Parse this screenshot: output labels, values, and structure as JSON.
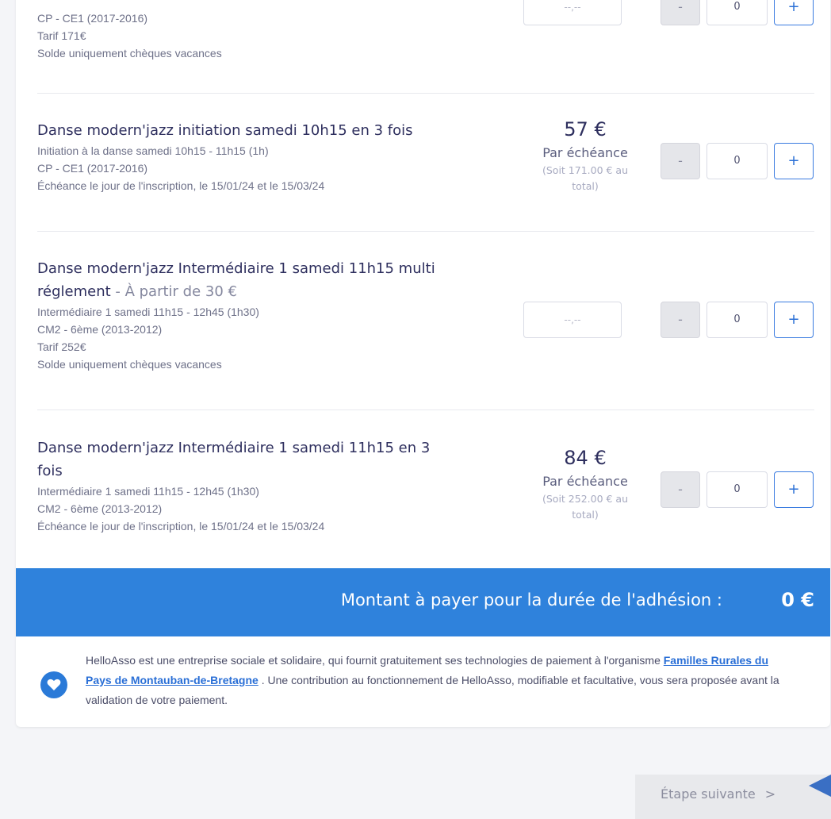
{
  "items": [
    {
      "lines": [
        "CP - CE1 (2017-2016)",
        "Tarif 171€",
        "Solde uniquement chèques vacances"
      ],
      "amount_placeholder": "--,--",
      "qty": "0"
    },
    {
      "title": "Danse modern'jazz initiation samedi 10h15 en 3 fois",
      "lines": [
        "Initiation à la danse samedi 10h15 - 11h15 (1h)",
        "CP - CE1 (2017-2016)",
        "Échéance le jour de l'inscription, le 15/01/24 et le 15/03/24"
      ],
      "price": "57 €",
      "price_label": "Par échéance",
      "price_total_1": "(Soit 171.00 € au",
      "price_total_2": "total)",
      "qty": "0"
    },
    {
      "title_1": "Danse modern'jazz Intermédiaire 1 samedi 11h15 multi",
      "title_2": "réglement",
      "from": " - À partir de 30 €",
      "lines": [
        "Intermédiaire 1 samedi 11h15 - 12h45 (1h30)",
        "CM2 - 6ème (2013-2012)",
        "Tarif 252€",
        "Solde uniquement chèques vacances"
      ],
      "amount_placeholder": "--,--",
      "qty": "0"
    },
    {
      "title_1": "Danse modern'jazz Intermédiaire 1 samedi 11h15 en 3",
      "title_2": "fois",
      "lines": [
        "Intermédiaire 1 samedi 11h15 - 12h45 (1h30)",
        "CM2 - 6ème (2013-2012)",
        "Échéance le jour de l'inscription, le 15/01/24 et le 15/03/24"
      ],
      "price": "84 €",
      "price_label": "Par échéance",
      "price_total_1": "(Soit 252.00 € au",
      "price_total_2": "total)",
      "qty": "0"
    }
  ],
  "buttons": {
    "minus": "-",
    "plus": "+"
  },
  "total": {
    "label": "Montant à payer pour la durée de l'adhésion :",
    "value": "0 €"
  },
  "info": {
    "text_1": "HelloAsso est une entreprise sociale et solidaire, qui fournit gratuitement ses technologies de paiement à l'organisme ",
    "link": "Familles Rurales du Pays de Montauban-de-Bretagne",
    "text_2": " . Une contribution au fonctionnement de HelloAsso, modifiable et facultative, vous sera proposée avant la validation de votre paiement."
  },
  "next": {
    "label": "Étape suivante",
    "chevron": ">"
  },
  "icons": {
    "heart": "heart-icon",
    "next": "chevron-right-icon",
    "pointer": "pointer-arrow-icon"
  },
  "colors": {
    "accent": "#2f82dc",
    "plus_border": "#3a7be0",
    "link": "#2a6fd6"
  }
}
